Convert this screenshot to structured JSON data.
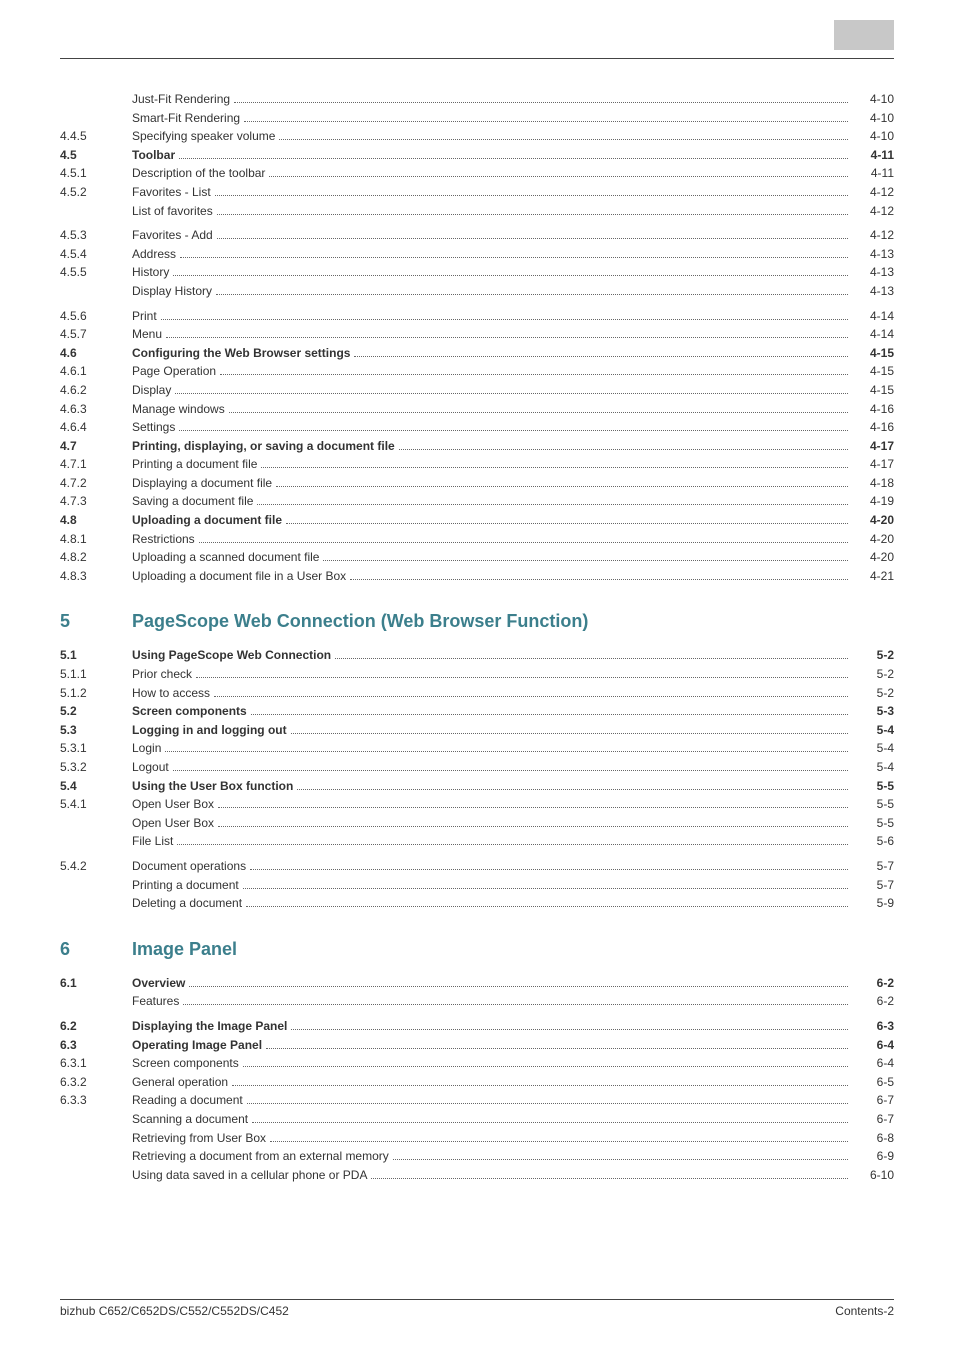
{
  "footer": {
    "left": "bizhub C652/C652DS/C552/C552DS/C452",
    "right": "Contents-2"
  },
  "sections": [
    {
      "items": [
        {
          "n": "",
          "t": "Just-Fit Rendering",
          "p": "4-10"
        },
        {
          "n": "",
          "t": "Smart-Fit Rendering",
          "p": "4-10"
        },
        {
          "n": "4.4.5",
          "t": "Specifying speaker volume",
          "p": "4-10"
        },
        {
          "n": "4.5",
          "t": "Toolbar",
          "p": "4-11",
          "b": true
        },
        {
          "n": "4.5.1",
          "t": "Description of the toolbar",
          "p": "4-11"
        },
        {
          "n": "4.5.2",
          "t": "Favorites - List",
          "p": "4-12"
        },
        {
          "n": "",
          "t": "List of favorites",
          "p": "4-12"
        },
        {
          "gap": true
        },
        {
          "n": "4.5.3",
          "t": "Favorites - Add",
          "p": "4-12"
        },
        {
          "n": "4.5.4",
          "t": "Address",
          "p": "4-13"
        },
        {
          "n": "4.5.5",
          "t": "History",
          "p": "4-13"
        },
        {
          "n": "",
          "t": "Display History",
          "p": "4-13"
        },
        {
          "gap": true
        },
        {
          "n": "4.5.6",
          "t": "Print",
          "p": "4-14"
        },
        {
          "n": "4.5.7",
          "t": "Menu",
          "p": "4-14"
        },
        {
          "n": "4.6",
          "t": "Configuring the Web Browser settings",
          "p": "4-15",
          "b": true
        },
        {
          "n": "4.6.1",
          "t": "Page Operation",
          "p": "4-15"
        },
        {
          "n": "4.6.2",
          "t": "Display",
          "p": "4-15"
        },
        {
          "n": "4.6.3",
          "t": "Manage windows",
          "p": "4-16"
        },
        {
          "n": "4.6.4",
          "t": "Settings",
          "p": "4-16"
        },
        {
          "n": "4.7",
          "t": "Printing, displaying, or saving a document file",
          "p": "4-17",
          "b": true
        },
        {
          "n": "4.7.1",
          "t": "Printing a document file",
          "p": "4-17"
        },
        {
          "n": "4.7.2",
          "t": "Displaying a document file",
          "p": "4-18"
        },
        {
          "n": "4.7.3",
          "t": "Saving a document file",
          "p": "4-19"
        },
        {
          "n": "4.8",
          "t": "Uploading a document file",
          "p": "4-20",
          "b": true
        },
        {
          "n": "4.8.1",
          "t": "Restrictions",
          "p": "4-20"
        },
        {
          "n": "4.8.2",
          "t": "Uploading a scanned document file",
          "p": "4-20"
        },
        {
          "n": "4.8.3",
          "t": "Uploading a document file in a User Box",
          "p": "4-21"
        }
      ]
    },
    {
      "chapter": {
        "num": "5",
        "title": "PageScope Web Connection (Web Browser Function)"
      },
      "items": [
        {
          "n": "5.1",
          "t": "Using PageScope Web Connection",
          "p": "5-2",
          "b": true
        },
        {
          "n": "5.1.1",
          "t": "Prior check",
          "p": "5-2"
        },
        {
          "n": "5.1.2",
          "t": "How to access",
          "p": "5-2"
        },
        {
          "n": "5.2",
          "t": "Screen components",
          "p": "5-3",
          "b": true
        },
        {
          "n": "5.3",
          "t": "Logging in and logging out",
          "p": "5-4",
          "b": true
        },
        {
          "n": "5.3.1",
          "t": "Login",
          "p": "5-4"
        },
        {
          "n": "5.3.2",
          "t": "Logout",
          "p": "5-4"
        },
        {
          "n": "5.4",
          "t": "Using the User Box function",
          "p": "5-5",
          "b": true
        },
        {
          "n": "5.4.1",
          "t": "Open User Box",
          "p": "5-5"
        },
        {
          "n": "",
          "t": "Open User Box",
          "p": "5-5"
        },
        {
          "n": "",
          "t": "File List",
          "p": "5-6"
        },
        {
          "gap": true
        },
        {
          "n": "5.4.2",
          "t": "Document operations",
          "p": "5-7"
        },
        {
          "n": "",
          "t": "Printing a document",
          "p": "5-7"
        },
        {
          "n": "",
          "t": "Deleting a document",
          "p": "5-9"
        }
      ]
    },
    {
      "chapter": {
        "num": "6",
        "title": "Image Panel"
      },
      "items": [
        {
          "n": "6.1",
          "t": "Overview",
          "p": "6-2",
          "b": true
        },
        {
          "n": "",
          "t": "Features",
          "p": "6-2"
        },
        {
          "gap": true
        },
        {
          "n": "6.2",
          "t": "Displaying the Image Panel",
          "p": "6-3",
          "b": true
        },
        {
          "n": "6.3",
          "t": "Operating Image Panel",
          "p": "6-4",
          "b": true
        },
        {
          "n": "6.3.1",
          "t": "Screen components",
          "p": "6-4"
        },
        {
          "n": "6.3.2",
          "t": "General operation",
          "p": "6-5"
        },
        {
          "n": "6.3.3",
          "t": "Reading a document",
          "p": "6-7"
        },
        {
          "n": "",
          "t": "Scanning a document",
          "p": "6-7"
        },
        {
          "n": "",
          "t": "Retrieving from User Box",
          "p": "6-8"
        },
        {
          "n": "",
          "t": "Retrieving a document from an external memory",
          "p": "6-9"
        },
        {
          "n": "",
          "t": "Using data saved in a cellular phone or PDA",
          "p": "6-10"
        }
      ]
    }
  ]
}
